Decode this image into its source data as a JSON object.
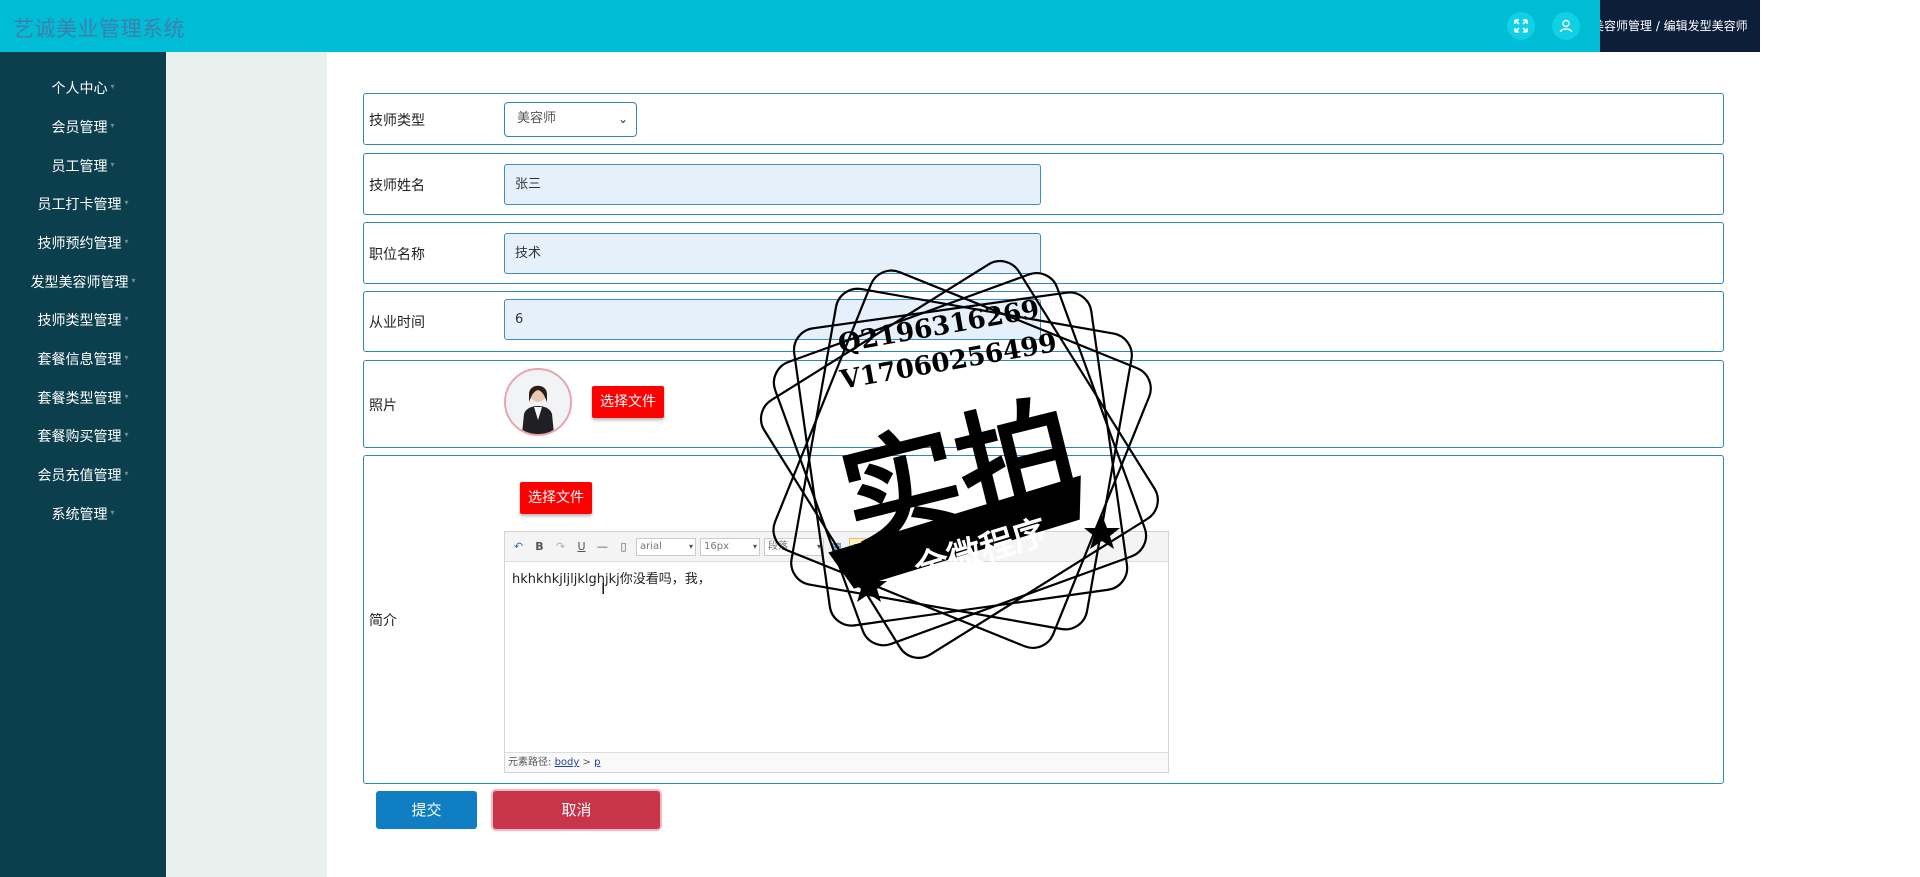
{
  "app": {
    "title": "艺诚美业管理系统"
  },
  "header": {
    "fullscreen_icon": "fullscreen-icon",
    "user_icon": "user-icon",
    "breadcrumb": "美容师管理 / 编辑发型美容师"
  },
  "sidebar": {
    "items": [
      {
        "label": "个人中心"
      },
      {
        "label": "会员管理"
      },
      {
        "label": "员工管理"
      },
      {
        "label": "员工打卡管理"
      },
      {
        "label": "技师预约管理"
      },
      {
        "label": "发型美容师管理"
      },
      {
        "label": "技师类型管理"
      },
      {
        "label": "套餐信息管理"
      },
      {
        "label": "套餐类型管理"
      },
      {
        "label": "套餐购买管理"
      },
      {
        "label": "会员充值管理"
      },
      {
        "label": "系统管理"
      }
    ]
  },
  "form": {
    "type": {
      "label": "技师类型",
      "value": "美容师"
    },
    "name": {
      "label": "技师姓名",
      "value": "张三"
    },
    "position": {
      "label": "职位名称",
      "value": "技术"
    },
    "years": {
      "label": "从业时间",
      "value": "6"
    },
    "photo": {
      "label": "照片",
      "upload_button": "选择文件"
    },
    "intro": {
      "label": "简介",
      "upload_button": "选择文件",
      "editor": {
        "font_family": "arial",
        "font_size": "16px",
        "paragraph": "段落",
        "content": "hkhkhkjljljklghjkj你没看吗，我，",
        "status_prefix": "元素路径:",
        "path_body": "body",
        "path_sep": ">",
        "path_p": "p"
      }
    },
    "submit": "提交",
    "cancel": "取消"
  },
  "watermark": {
    "line1": "Q2196316269",
    "line2": "V17060256499",
    "big": "实拍",
    "ribbon": "全微程序"
  }
}
